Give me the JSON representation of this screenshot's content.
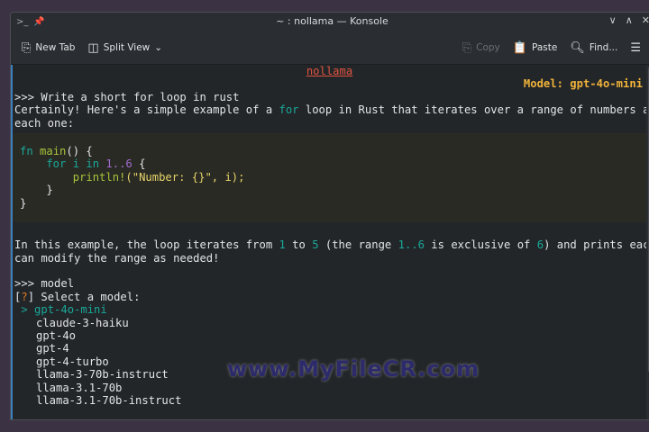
{
  "window": {
    "title": "~ : nollama — Konsole"
  },
  "toolbar": {
    "new_tab": "New Tab",
    "split_view": "Split View",
    "copy": "Copy",
    "paste": "Paste",
    "find": "Find..."
  },
  "terminal": {
    "header": "nollama",
    "model_label": "Model: gpt-4o-mini",
    "prompt1": ">>> Write a short for loop in rust",
    "resp1_a": "Certainly! Here's a simple example of a ",
    "resp1_kw": "for",
    "resp1_b": " loop in Rust that iterates over a range of numbers and prints",
    "resp1_c": "each one:",
    "code": {
      "l1a": "fn ",
      "l1b": "main",
      "l1c": "() {",
      "l2a": "    for i in ",
      "l2b": "1..6",
      "l2c": " {",
      "l3a": "        println!",
      "l3b": "(\"Number: {}\", i);",
      "l4": "    }",
      "l5": "}"
    },
    "expl": {
      "a": "In this example, the loop iterates from ",
      "n1": "1",
      "b": " to ",
      "n2": "5",
      "c": " (the range ",
      "n3": "1..6",
      "d": " is exclusive of ",
      "n4": "6",
      "e": ") and prints each number. You",
      "f": "can modify the range as needed!"
    },
    "prompt2": ">>> model",
    "select": {
      "open": "[",
      "q": "?",
      "close": "] Select a model:",
      "cursor": " > "
    },
    "models": [
      "gpt-4o-mini",
      "claude-3-haiku",
      "gpt-4o",
      "gpt-4",
      "gpt-4-turbo",
      "llama-3-70b-instruct",
      "llama-3.1-70b",
      "llama-3.1-70b-instruct"
    ]
  },
  "watermark": "www.MyFileCR.com"
}
